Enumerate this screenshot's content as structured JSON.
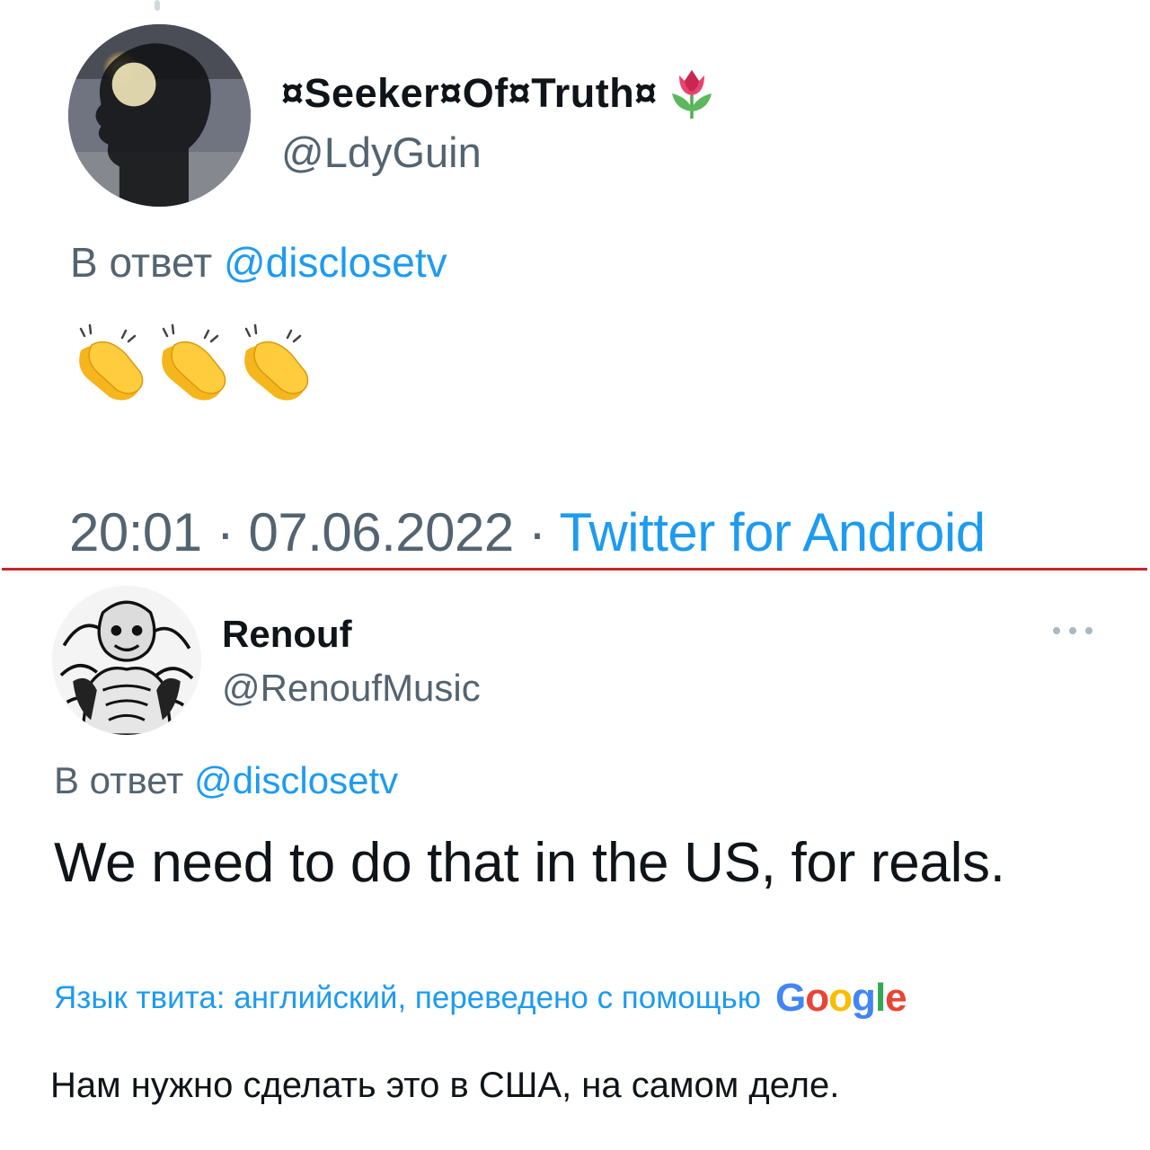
{
  "tweet1": {
    "display_name": "¤Seeker¤Of¤Truth¤",
    "name_emoji": "tulip-icon",
    "handle": "@LdyGuin",
    "reply_prefix": "В ответ",
    "reply_mention": "@disclosetv",
    "body_emoji": [
      "clapping-hands-icon",
      "clapping-hands-icon",
      "clapping-hands-icon"
    ],
    "time": "20:01",
    "date": "07.06.2022",
    "source": "Twitter for Android",
    "separator": " · "
  },
  "tweet2": {
    "display_name": "Renouf",
    "handle": "@RenoufMusic",
    "reply_prefix": "В ответ",
    "reply_mention": "@disclosetv",
    "text": "We need to do that in the US, for reals.",
    "translation_note": "Язык твита: английский, переведено с помощью",
    "translation_provider": {
      "letters": [
        "G",
        "o",
        "o",
        "g",
        "l",
        "e"
      ],
      "colors": [
        "#4285F4",
        "#EA4335",
        "#FBBC05",
        "#4285F4",
        "#34A853",
        "#EA4335"
      ]
    },
    "translated_text": "Нам нужно сделать это в США, на самом деле."
  },
  "colors": {
    "link": "#1d9bf0",
    "secondary_text": "#536471",
    "primary_text": "#0f1419",
    "divider": "#c62828"
  }
}
